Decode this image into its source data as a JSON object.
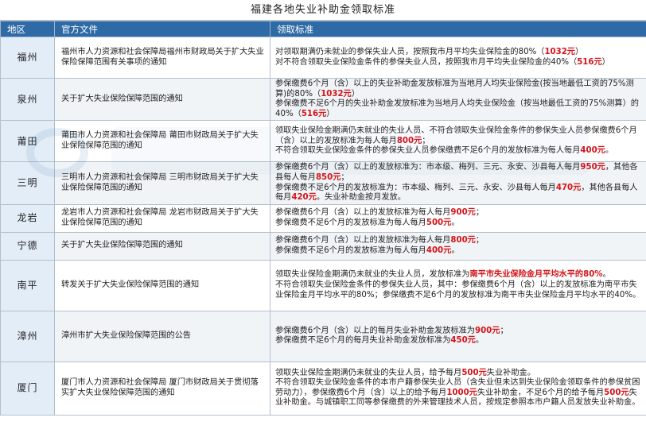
{
  "page": {
    "title": "福建各地失业补助金领取标准"
  },
  "table": {
    "headers": [
      "地区",
      "官方文件",
      "领取标准"
    ],
    "rows": [
      {
        "region": "福州",
        "doc": "福州市人力资源和社会保障局福州市财政局关于扩大失业保险保障范围有关事项的通知",
        "lines": [
          [
            {
              "t": "对领取期满仍未就业的参保失业人员，按照我市月平均失业保险金的80%（",
              "r": false
            },
            {
              "t": "1032元",
              "r": true
            },
            {
              "t": "）",
              "r": false
            }
          ],
          [
            {
              "t": "对不符合领取失业保险金条件的参保失业人员，按照我市月平均失业保险金的40%（",
              "r": false
            },
            {
              "t": "516元",
              "r": true
            },
            {
              "t": "）",
              "r": false
            }
          ]
        ]
      },
      {
        "region": "泉州",
        "doc": "关于扩大失业保险保障范围的通知",
        "lines": [
          [
            {
              "t": "参保缴费6个月（含）以上的失业补助金发放标准为当地月人均失业保险金(按当地最低工资的75%测算)的80%（",
              "r": false
            },
            {
              "t": "1032元",
              "r": true
            },
            {
              "t": "）",
              "r": false
            }
          ],
          [
            {
              "t": "参保缴费不足6个月的失业补助金发放标准为当地月人均失业保险金（按当地最低工资的75%测算）的40%（",
              "r": false
            },
            {
              "t": "516元",
              "r": true
            },
            {
              "t": "）",
              "r": false
            }
          ]
        ]
      },
      {
        "region": "莆田",
        "doc": "莆田市人力资源和社会保障局 莆田市财政局关于扩大失业保险保障范围的通知",
        "lines": [
          [
            {
              "t": "领取失业保险金期满仍未就业的失业人员、不符合领取失业保险金条件的参保失业人员参保缴费6个月（含）以上的发放标准为每人每月",
              "r": false
            },
            {
              "t": "800元",
              "r": true
            },
            {
              "t": "；",
              "r": false
            }
          ],
          [
            {
              "t": "不符合领取失业保险金条件的参保失业人员参保缴费不足6个月的发放标准为每人每月",
              "r": false
            },
            {
              "t": "400元",
              "r": true
            },
            {
              "t": "。",
              "r": false
            }
          ]
        ]
      },
      {
        "region": "三明",
        "doc": "三明市人力资源和社会保障局 三明市财政局关于扩大失业保险保障范围的通知",
        "lines": [
          [
            {
              "t": "参保缴费6个月（含）以上的发放标准为：市本级、梅列、三元、永安、沙县每人每月",
              "r": false
            },
            {
              "t": "950元",
              "r": true
            },
            {
              "t": "，其他各县每人每月",
              "r": false
            },
            {
              "t": "850元",
              "r": true
            },
            {
              "t": "；",
              "r": false
            }
          ],
          [
            {
              "t": "参保缴费不足6个月的发放标准为：市本级、梅列、三元、永安、沙县每人每月",
              "r": false
            },
            {
              "t": "470元",
              "r": true
            },
            {
              "t": "，其他各县每人每月",
              "r": false
            },
            {
              "t": "420元",
              "r": true
            },
            {
              "t": "。失业补助金按月发放。",
              "r": false
            }
          ]
        ]
      },
      {
        "region": "龙岩",
        "doc": "龙岩市人力资源和社会保障局 龙岩市财政局关于扩大失业保险保障范围的通知",
        "lines": [
          [
            {
              "t": "参保缴费6个月（含）以上的发放标准为每人每月",
              "r": false
            },
            {
              "t": "900元",
              "r": true
            },
            {
              "t": "；",
              "r": false
            }
          ],
          [
            {
              "t": "参保缴费不足6个月的发放标准为每人每月",
              "r": false
            },
            {
              "t": "500元",
              "r": true
            },
            {
              "t": "。",
              "r": false
            }
          ]
        ]
      },
      {
        "region": "宁德",
        "doc": "关于扩大失业保险保障范围的通知",
        "lines": [
          [
            {
              "t": "参保缴费6个月（含）以上的发放标准为每人每月",
              "r": false
            },
            {
              "t": "800元",
              "r": true
            },
            {
              "t": "；",
              "r": false
            }
          ],
          [
            {
              "t": "参保缴费不足6个月的发放标准为每人每月",
              "r": false
            },
            {
              "t": "400元",
              "r": true
            },
            {
              "t": "。",
              "r": false
            }
          ]
        ]
      },
      {
        "region": "南平",
        "doc": "转发关于扩大失业保险保障范围的通知",
        "lines": [
          [
            {
              "t": "领取失业保险金期满仍未就业的失业人员，发放标准为",
              "r": false
            },
            {
              "t": "南平市失业保险金月平均水平的80%",
              "r": true
            },
            {
              "t": "。",
              "r": false
            }
          ],
          [
            {
              "t": "不符合领取失业保险金条件的参保失业人员，其中：参保缴费6个月（含）以上的发放标准为南平市失业保险金月平均水平的80%；参保缴费不足6个月的发放标准为南平市失业保险金月平均水平的40%。",
              "r": false
            }
          ]
        ]
      },
      {
        "region": "漳州",
        "doc": "漳州市扩大失业保险保障范围的公告",
        "lines": [
          [
            {
              "t": "参保缴费6个月（含）以上的每月失业补助金发放标准为",
              "r": false
            },
            {
              "t": "900元",
              "r": true
            },
            {
              "t": "；",
              "r": false
            }
          ],
          [
            {
              "t": "参保缴费不足6个月的每月失业补助金发放标准为",
              "r": false
            },
            {
              "t": "450元",
              "r": true
            },
            {
              "t": "。",
              "r": false
            }
          ]
        ]
      },
      {
        "region": "厦门",
        "doc": "厦门市人力资源和社会保障局 厦门市财政局关于贯彻落实扩大失业保险保障范围的通知",
        "lines": [
          [
            {
              "t": "领取失业保险金期满仍未就业的失业人员，给予每月",
              "r": false
            },
            {
              "t": "500元",
              "r": true
            },
            {
              "t": "失业补助金。",
              "r": false
            }
          ],
          [
            {
              "t": "不符合领取失业保险金条件的本市户籍参保失业人员（含失业但未达到失业保险金领取条件的参保贫困劳动力），参保缴费6个月（含）以上的给予每月",
              "r": false
            },
            {
              "t": "1000元",
              "r": true
            },
            {
              "t": "失业补助金，不足6个月的给予每月",
              "r": false
            },
            {
              "t": "500元",
              "r": true
            },
            {
              "t": "失业补助金。与城镇职工同等参保缴费的外来管理技术人员，按规定参照本市户籍人员发放失业补助金。",
              "r": false
            }
          ]
        ]
      }
    ]
  }
}
